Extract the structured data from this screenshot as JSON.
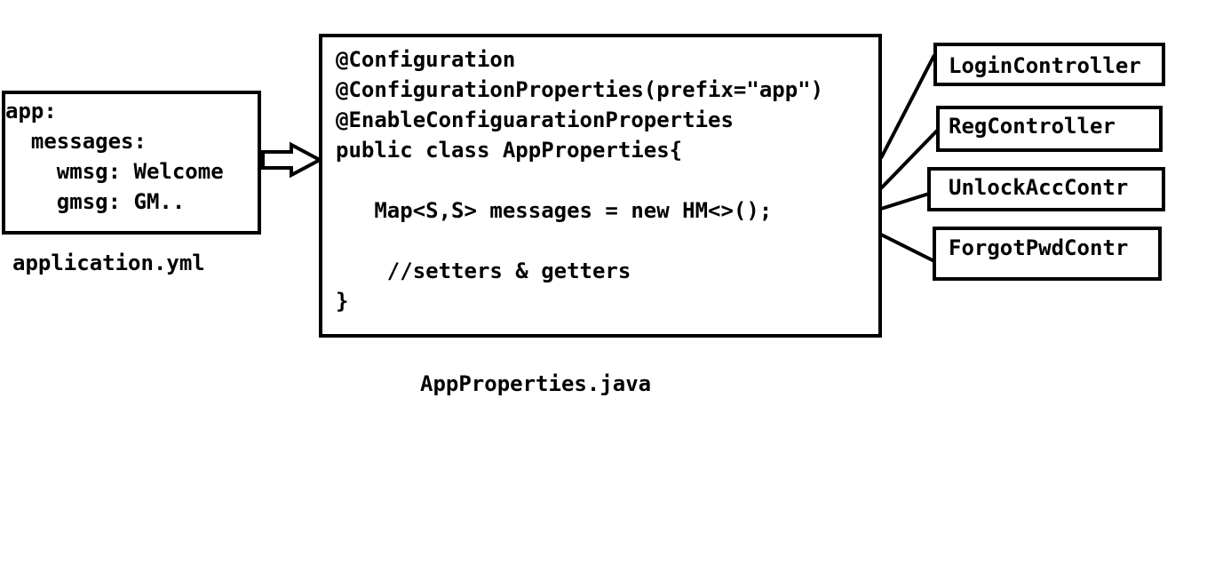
{
  "yml_box": {
    "lines": [
      "app:",
      "  messages:",
      "    wmsg: Welcome",
      "    gmsg: GM.."
    ],
    "caption": "application.yml"
  },
  "java_box": {
    "lines": [
      "@Configuration",
      "@ConfigurationProperties(prefix=\"app\")",
      "@EnableConfiguarationProperties",
      "public class AppProperties{",
      "",
      "   Map<S,S> messages = new HM<>();",
      "",
      "    //setters & getters",
      "}"
    ],
    "caption": "AppProperties.java"
  },
  "controllers": [
    {
      "label": "LoginController"
    },
    {
      "label": "RegController"
    },
    {
      "label": "UnlockAccContr"
    },
    {
      "label": "ForgotPwdContr"
    }
  ],
  "colors": {
    "stroke": "#000000",
    "background": "#ffffff"
  }
}
